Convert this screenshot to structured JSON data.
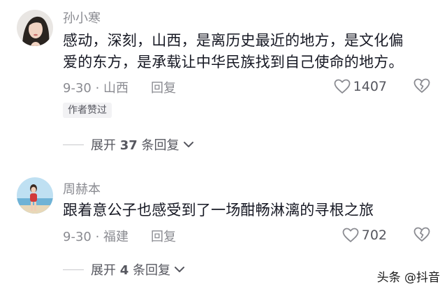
{
  "comments": [
    {
      "username": "孙小寒",
      "text_line1": "感动，深刻，山西，是离历史最近的地方，是文化偏",
      "text_line2": "爱的东方，是承载让中华民族找到自己使命的地方。",
      "date": "9-30",
      "location": "山西",
      "time_location": "9-30 · 山西",
      "reply_label": "回复",
      "like_count": "1407",
      "author_liked_badge": "作者赞过",
      "expand_prefix": "展开",
      "expand_count": "37",
      "expand_suffix": "条回复"
    },
    {
      "username": "周赫本",
      "text_line1": "跟着意公子也感受到了一场酣畅淋漓的寻根之旅",
      "date": "9-30",
      "location": "福建",
      "time_location": "9-30 · 福建",
      "reply_label": "回复",
      "like_count": "702",
      "expand_prefix": "展开",
      "expand_count": "4",
      "expand_suffix": "条回复"
    }
  ],
  "watermark": "头条 @抖音",
  "colors": {
    "text_primary": "#161823",
    "text_secondary": "#8a8b91",
    "badge_bg": "#f2f2f4"
  },
  "icons": {
    "like": "heart-outline-icon",
    "dislike": "broken-heart-icon",
    "expand": "chevron-down-icon"
  }
}
